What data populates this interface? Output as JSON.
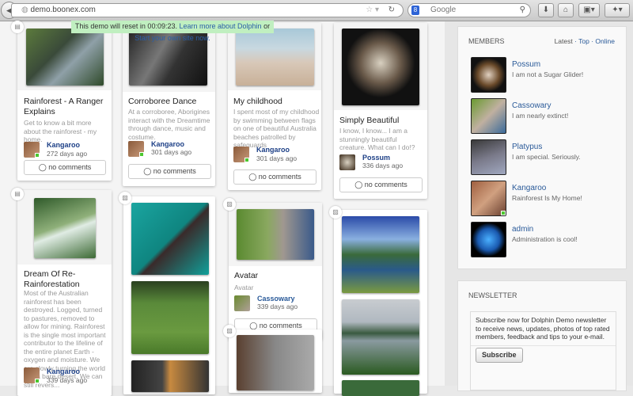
{
  "browser": {
    "url": "demo.boonex.com",
    "search_placeholder": "Google"
  },
  "demo_bar": {
    "text": "This demo will reset in 00:09:23.",
    "link1": "Learn more about Dolphin",
    "or": " or ",
    "link2": "Start your own site now."
  },
  "cards": [
    {
      "title": "Rainforest - A Ranger Explains",
      "desc": "Get to know a bit more about the rainforest - my home.",
      "author": "Kangaroo",
      "date": "272 days ago",
      "comments": "no comments"
    },
    {
      "title": "Corroboree Dance",
      "desc": "At a corroboree, Aborigines interact with the Dreamtime through dance, music and costume.",
      "author": "Kangaroo",
      "date": "301 days ago",
      "comments": "no comments"
    },
    {
      "title": "My childhood",
      "desc": "I spent most of my childhood by swimming between flags on one of beautiful Australia beaches patrolled by safeguards",
      "author": "Kangaroo",
      "date": "301 days ago",
      "comments": "no comments"
    },
    {
      "title": "Simply Beautiful",
      "desc": "I know, I know... I am a stunningly beautiful creature. What can I do!?",
      "author": "Possum",
      "date": "336 days ago",
      "comments": "no comments"
    },
    {
      "title": "Dream Of Re-Rainforestation",
      "desc": "Most of the Australian rainforest has been destroyed. Logged, turned to pastures, removed to allow for mining. Rainforest is the single most important contributor to the lifeline of the entire planet Earth - oxygen and moisture. We are slowly turning the world into a bare desert. We can still revers...",
      "author": "Kangaroo",
      "date": "339 days ago"
    },
    {
      "title": "Avatar",
      "desc": "Avatar",
      "author": "Cassowary",
      "date": "339 days ago",
      "comments": "no comments"
    }
  ],
  "members": {
    "heading": "MEMBERS",
    "tabs": [
      "Latest",
      "Top",
      "Online"
    ],
    "sep": " · ",
    "items": [
      {
        "name": "Possum",
        "status": "I am not a Sugar Glider!"
      },
      {
        "name": "Cassowary",
        "status": "I am nearly extinct!"
      },
      {
        "name": "Platypus",
        "status": "I am special. Seriously."
      },
      {
        "name": "Kangaroo",
        "status": "Rainforest Is My Home!"
      },
      {
        "name": "admin",
        "status": "Administration is cool!"
      }
    ]
  },
  "newsletter": {
    "heading": "NEWSLETTER",
    "text": "Subscribe now for Dolphin Demo newsletter to receive news, updates, photos of top rated members, feedback and tips to your e-mail.",
    "button": "Subscribe"
  },
  "colors": {
    "online": "#4bc72f",
    "link": "#2a5a99",
    "demo_bar": "#c0efc0"
  }
}
